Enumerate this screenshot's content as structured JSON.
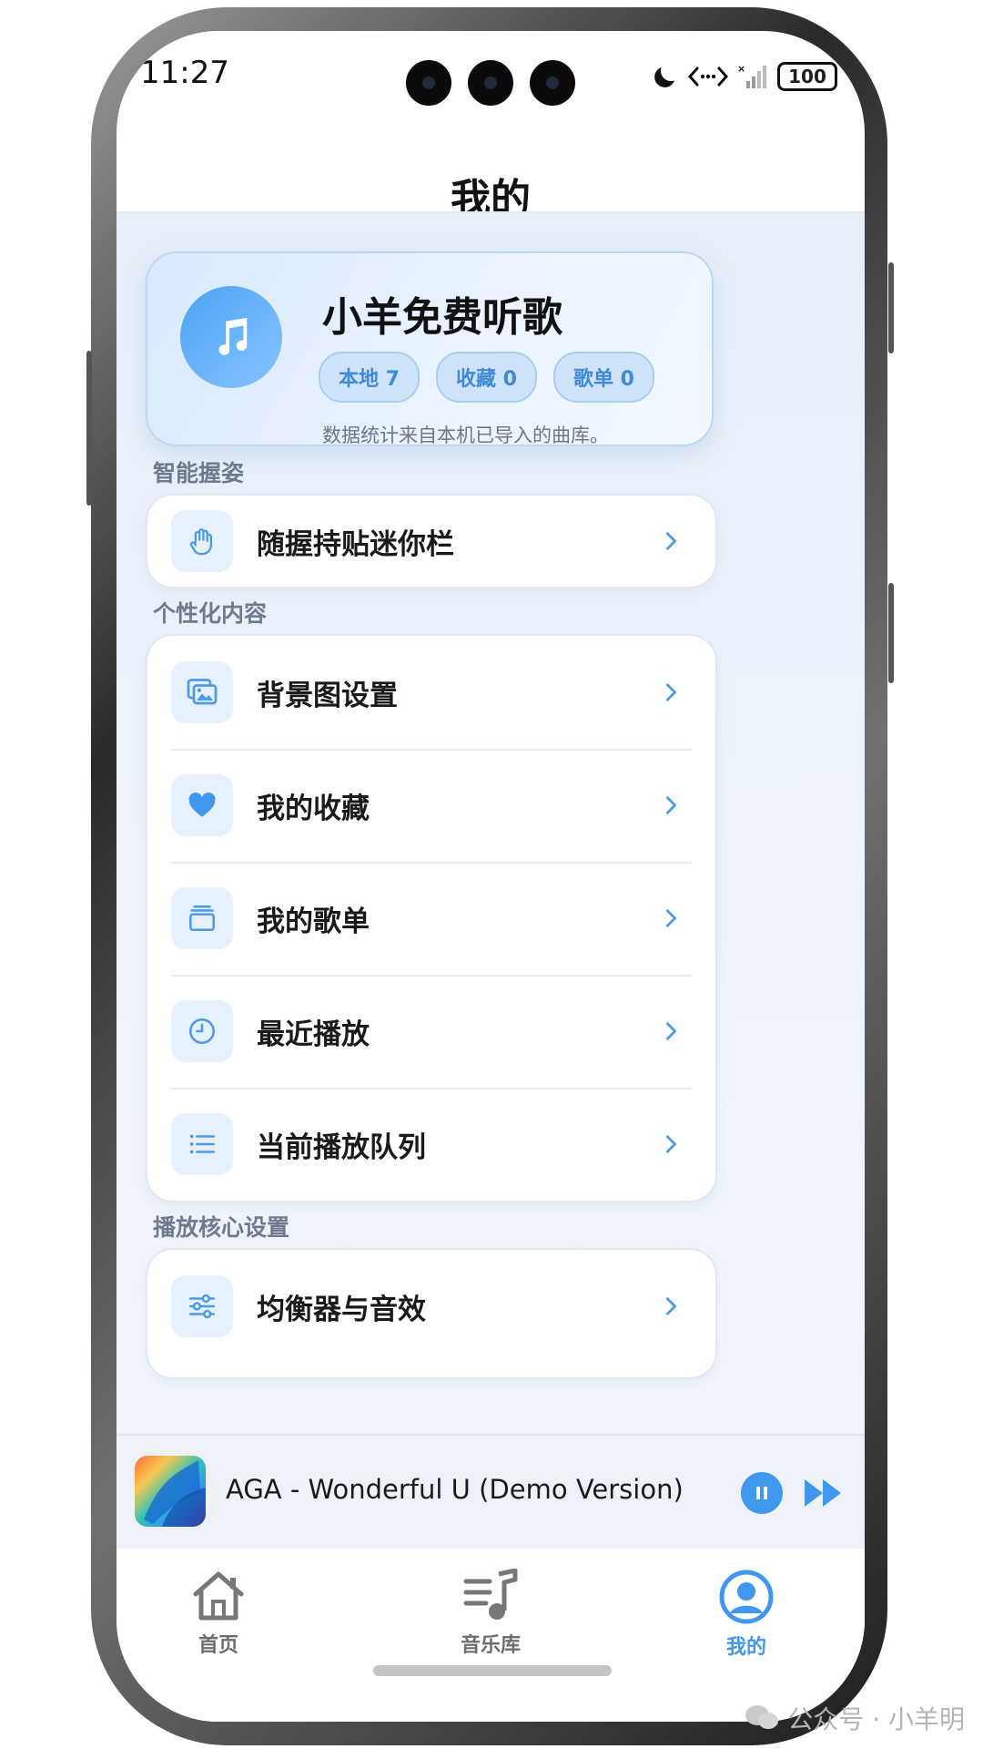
{
  "status_bar": {
    "time": "11:27",
    "battery": "100"
  },
  "header": {
    "title": "我的"
  },
  "profile": {
    "name": "小羊免费听歌",
    "stats": [
      "本地 7",
      "收藏 0",
      "歌单 0"
    ],
    "note": "数据统计来自本机已导入的曲库。"
  },
  "sections": [
    {
      "title": "智能握姿",
      "items": [
        {
          "label": "随握持贴迷你栏",
          "icon": "hand-icon"
        }
      ]
    },
    {
      "title": "个性化内容",
      "items": [
        {
          "label": "背景图设置",
          "icon": "image-icon"
        },
        {
          "label": "我的收藏",
          "icon": "heart-icon"
        },
        {
          "label": "我的歌单",
          "icon": "playlist-icon"
        },
        {
          "label": "最近播放",
          "icon": "clock-icon"
        },
        {
          "label": "当前播放队列",
          "icon": "list-icon"
        }
      ]
    },
    {
      "title": "播放核心设置",
      "items": [
        {
          "label": "均衡器与音效",
          "icon": "equalizer-icon"
        }
      ]
    }
  ],
  "mini_player": {
    "track": "AGA - Wonderful U (Demo Version)",
    "state": "playing"
  },
  "tabs": [
    {
      "label": "首页",
      "icon": "home-icon",
      "active": false
    },
    {
      "label": "音乐库",
      "icon": "library-icon",
      "active": false
    },
    {
      "label": "我的",
      "icon": "user-icon",
      "active": true
    }
  ],
  "watermark": "公众号 · 小羊明",
  "colors": {
    "accent": "#3f97ee",
    "chip": "#cfe4fb",
    "text": "#1a1a1a",
    "muted": "#6e7b8f"
  }
}
